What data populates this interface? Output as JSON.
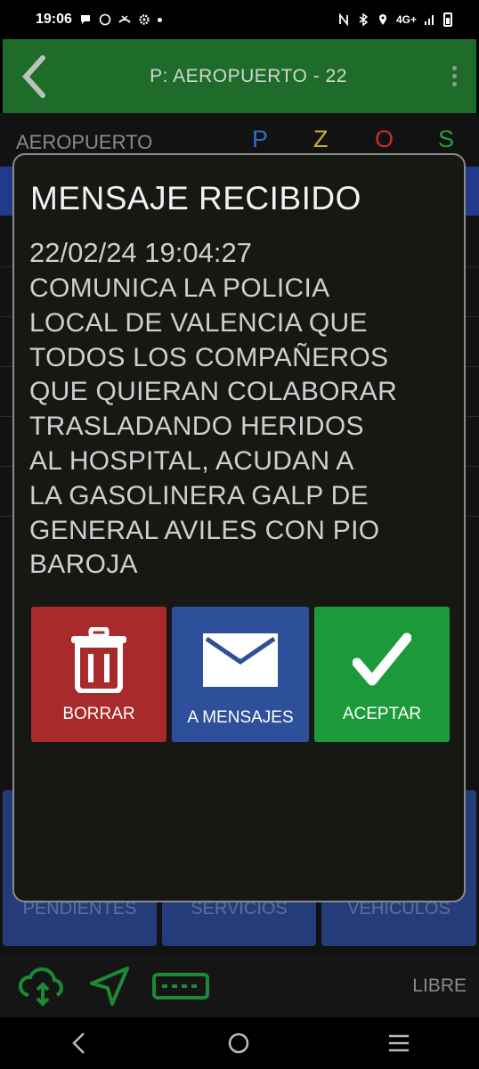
{
  "status_bar": {
    "time": "19:06",
    "network": "4G+",
    "icons": [
      "chat-bubble-icon",
      "whatsapp-icon",
      "missed-call-icon",
      "settings-icon",
      "nfc-icon",
      "bluetooth-icon",
      "location-icon",
      "signal-icon",
      "battery-icon"
    ]
  },
  "app_bar": {
    "title": "P: AEROPUERTO - 22",
    "color": "#1e6b2a"
  },
  "background": {
    "stop_label": "AEROPUERTO",
    "pzos": [
      {
        "letter": "P",
        "color": "#2a6fc9"
      },
      {
        "letter": "Z",
        "color": "#c9b02a"
      },
      {
        "letter": "O",
        "color": "#c92a2a"
      },
      {
        "letter": "S",
        "color": "#2a9a3a"
      }
    ],
    "tabs": [
      "PENDIENTES",
      "SERVICIOS",
      "VEHICULOS"
    ],
    "status_text": "LIBRE"
  },
  "dialog": {
    "title": "MENSAJE RECIBIDO",
    "date": "22/02/24 19:04:27",
    "message_lines": [
      "COMUNICA LA POLICIA",
      "LOCAL DE VALENCIA QUE",
      "TODOS LOS COMPAÑEROS",
      "QUE QUIERAN COLABORAR",
      "TRASLADANDO HERIDOS",
      "AL HOSPITAL, ACUDAN A",
      "LA GASOLINERA GALP DE",
      "GENERAL AVILES CON PIO",
      "BAROJA"
    ],
    "buttons": {
      "delete": "BORRAR",
      "messages": "A MENSAJES",
      "accept": "ACEPTAR"
    }
  }
}
